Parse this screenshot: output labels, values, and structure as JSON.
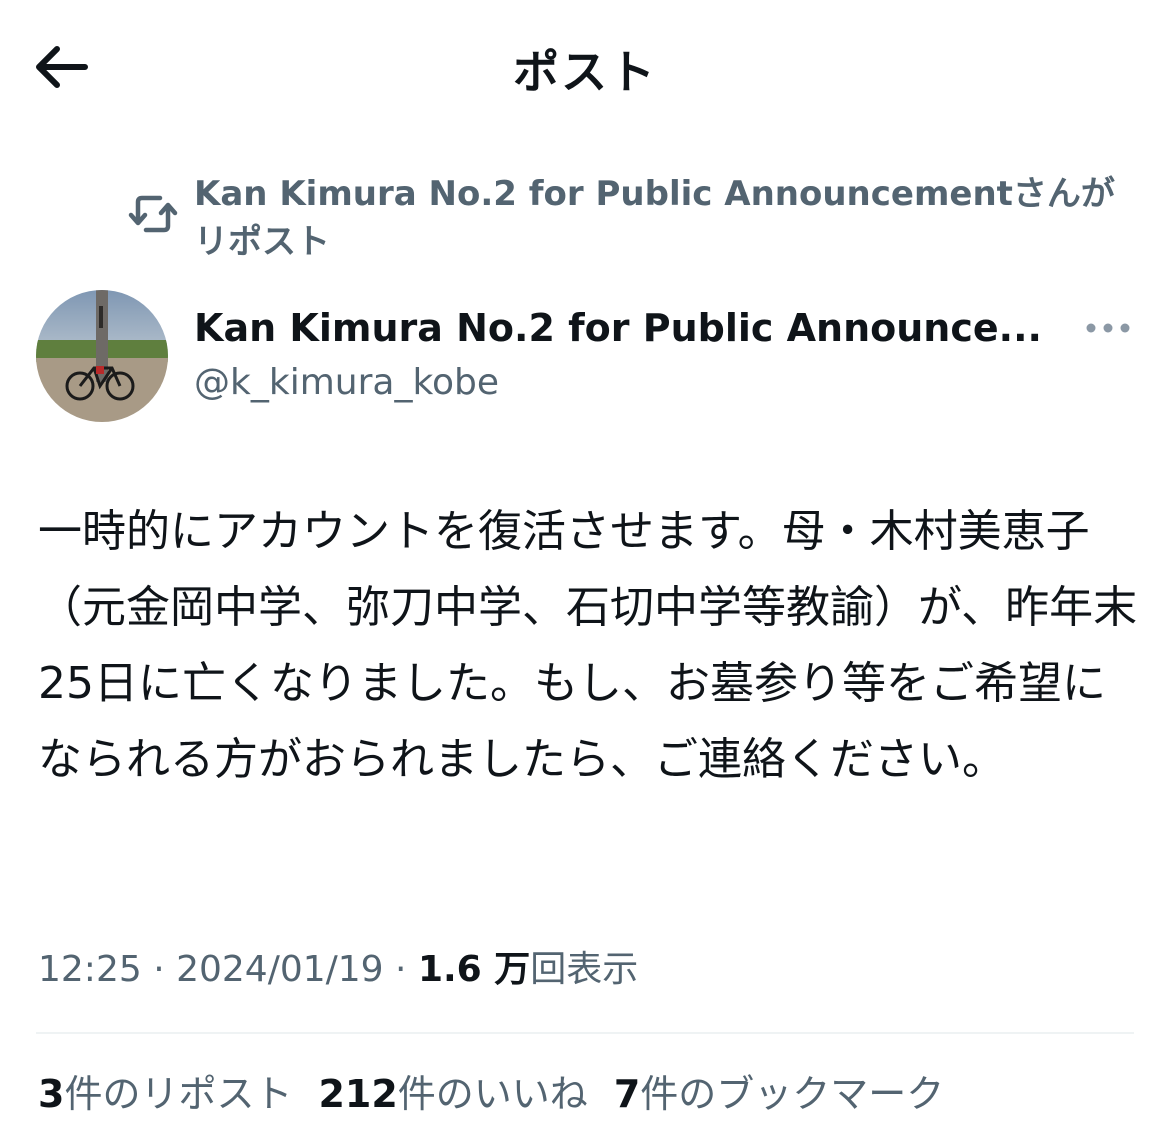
{
  "header": {
    "title": "ポスト",
    "back_icon": "arrow-left-icon"
  },
  "repost_context": {
    "icon": "repost-icon",
    "text": "Kan Kimura No.2 for Public Announcementさんがリポスト"
  },
  "author": {
    "display_name": "Kan Kimura No.2 for Public Announce...",
    "handle": "@k_kimura_kobe",
    "more_icon": "more-horizontal-icon"
  },
  "post": {
    "text": "一時的にアカウントを復活させます。母・木村美恵子（元金岡中学、弥刀中学、石切中学等教諭）が、昨年末25日に亡くなりました。もし、お墓参り等をご希望になられる方がおられましたら、ご連絡ください。"
  },
  "meta": {
    "time": "12:25",
    "separator1": " · ",
    "date": "2024/01/19",
    "separator2": " · ",
    "views_count": "1.6 万",
    "views_label": "回表示"
  },
  "stats": {
    "reposts_count": "3",
    "reposts_label": "件のリポスト",
    "likes_count": "212",
    "likes_label": "件のいいね",
    "bookmarks_count": "7",
    "bookmarks_label": "件のブックマーク"
  },
  "colors": {
    "text_primary": "#0f1419",
    "text_secondary": "#536471",
    "divider": "#eff3f4"
  }
}
